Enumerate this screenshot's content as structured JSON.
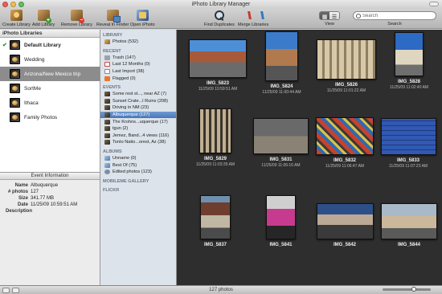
{
  "window": {
    "title": "iPhoto Library Manager"
  },
  "toolbar": {
    "create_library": "Create Library",
    "add_library": "Add Library",
    "remove_library": "Remove Library",
    "reveal_in_finder": "Reveal In Finder",
    "open_iphoto": "Open iPhoto",
    "find_duplicates": "Find Duplicates",
    "merge_libraries": "Merge Libraries",
    "view_label": "View",
    "search_label": "Search",
    "search_placeholder": "Search"
  },
  "libraries": {
    "header": "iPhoto Libraries",
    "items": [
      {
        "label": "Default Library",
        "checked": true
      },
      {
        "label": "Wedding"
      },
      {
        "label": "Arizona/New Mexico trip",
        "selected": true
      },
      {
        "label": "SortMe"
      },
      {
        "label": "Ithaca"
      },
      {
        "label": "Family Photos"
      }
    ]
  },
  "event_info": {
    "title": "Event Information",
    "name_label": "Name",
    "name": "Albuquerque",
    "photos_label": "# photos",
    "photos": "127",
    "size_label": "Size",
    "size": "341.77 MB",
    "date_label": "Date",
    "date": "11/25/09 10:59:51 AM",
    "description_label": "Description"
  },
  "source": {
    "library_header": "LIBRARY",
    "photos": "Photos (532)",
    "recent_header": "RECENT",
    "recent": [
      "Trash (147)",
      "Last 12 Months (0)",
      "Last Import (38)",
      "Flagged (0)"
    ],
    "events_header": "EVENTS",
    "events": [
      "Some rest st..., near AZ (7)",
      "Sunset Crate...l Ruins (208)",
      "Driving in NM (23)",
      "Albuquerque (127)",
      "The Krohns...uquerque (17)",
      "tgun (2)",
      "Jemez, Band...4 views (116)",
      "Tonto Natio...orest, Az (38)"
    ],
    "albums_header": "ALBUMS",
    "albums": [
      "Unname (0)",
      "Best Of (75)",
      "Edited photos (123)"
    ],
    "mobileme_header": "MOBILEME GALLERY",
    "flickr_header": "FLICKR"
  },
  "photos": [
    {
      "name": "IMG_5823",
      "date": "11/25/09 10:59:51 AM"
    },
    {
      "name": "IMG_5824",
      "date": "11/25/09 11:00:44 AM"
    },
    {
      "name": "IMG_5826",
      "date": "11/25/09 11:01:22 AM"
    },
    {
      "name": "IMG_5828",
      "date": "11/25/09 11:02:40 AM"
    },
    {
      "name": "IMG_5829",
      "date": "11/25/09 11:03:35 AM"
    },
    {
      "name": "IMG_5831",
      "date": "11/25/09 11:06:16 AM"
    },
    {
      "name": "IMG_5832",
      "date": "11/25/09 11:06:47 AM"
    },
    {
      "name": "IMG_5833",
      "date": "11/25/09 11:07:23 AM"
    },
    {
      "name": "IMG_5837",
      "date": ""
    },
    {
      "name": "IMG_5841",
      "date": ""
    },
    {
      "name": "IMG_5842",
      "date": ""
    },
    {
      "name": "IMG_5844",
      "date": ""
    }
  ],
  "status": {
    "count": "127 photos"
  }
}
